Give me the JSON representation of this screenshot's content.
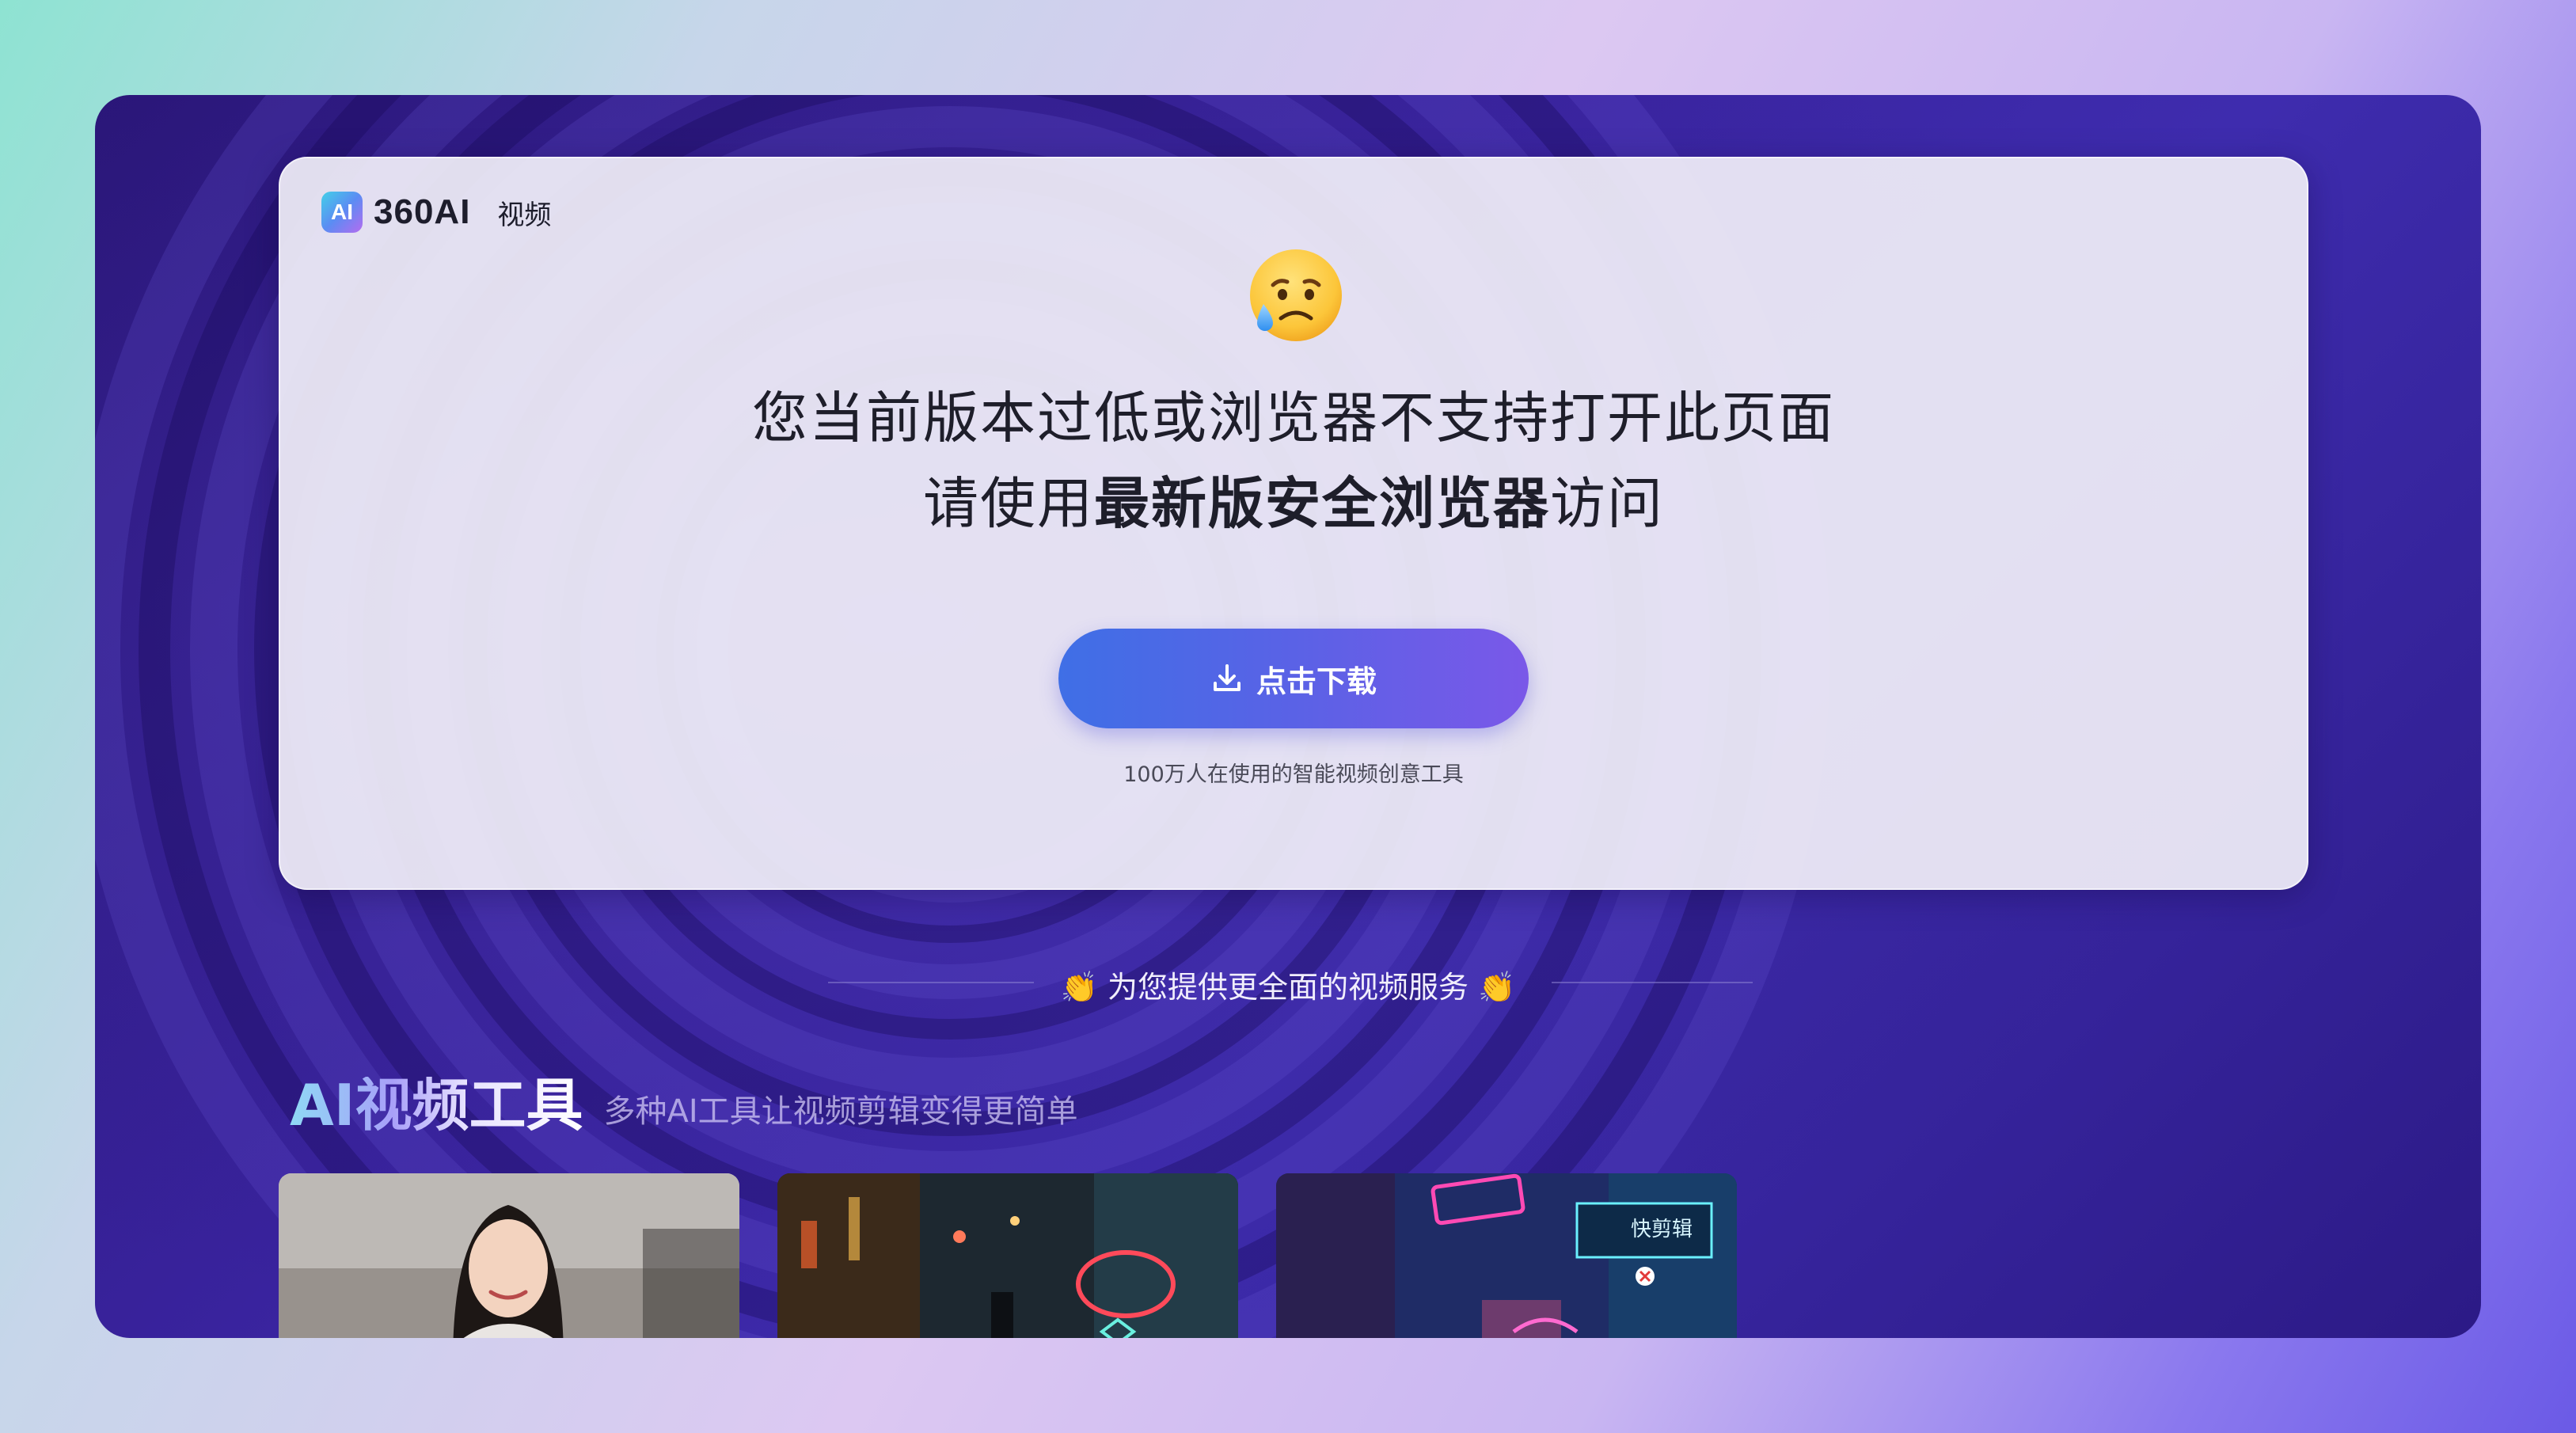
{
  "header": {
    "logo_badge": "AI",
    "logo_brand": "360AI",
    "logo_sub": "视频"
  },
  "message": {
    "emoji": "sad-face-with-tear-icon",
    "line1": "您当前版本过低或浏览器不支持打开此页面",
    "line2_prefix": "请使用",
    "line2_bold": "最新版安全浏览器",
    "line2_suffix": "访问"
  },
  "download": {
    "button_label": "点击下载",
    "icon": "download-icon",
    "note": "100万人在使用的智能视频创意工具"
  },
  "divider": {
    "text": "👏 为您提供更全面的视频服务 👏"
  },
  "section": {
    "title": "AI视频工具",
    "subtitle": "多种AI工具让视频剪辑变得更简单"
  },
  "thumbnails": [
    {
      "name": "portrait-woman-thumbnail"
    },
    {
      "name": "cyberpunk-street-thumbnail"
    },
    {
      "name": "neon-pizza-street-thumbnail",
      "overlay_label": "快剪辑"
    }
  ],
  "colors": {
    "button_start": "#3f6fe6",
    "button_end": "#7a58e8",
    "window_bg": "#2a1678"
  }
}
